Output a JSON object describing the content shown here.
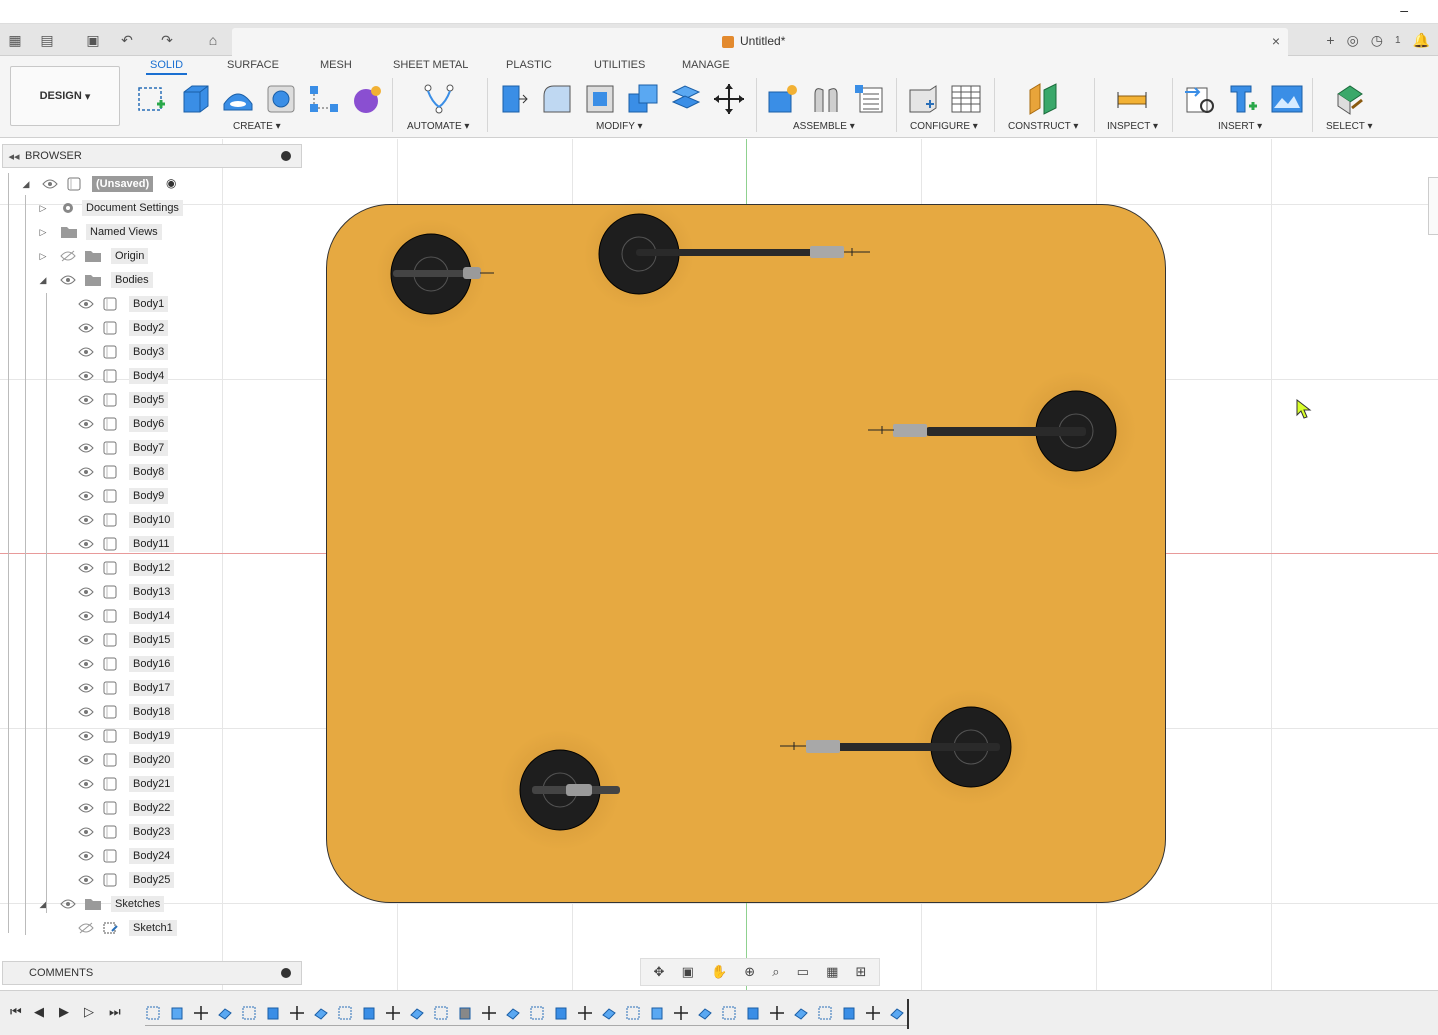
{
  "window": {
    "doc_title": "Untitled*",
    "minimize_glyph": "–",
    "close_glyph": "×"
  },
  "workspace": {
    "label": "DESIGN",
    "dropdown_glyph": "▾"
  },
  "tabs": [
    {
      "label": "SOLID",
      "active": true
    },
    {
      "label": "SURFACE"
    },
    {
      "label": "MESH"
    },
    {
      "label": "SHEET METAL"
    },
    {
      "label": "PLASTIC"
    },
    {
      "label": "UTILITIES"
    },
    {
      "label": "MANAGE"
    }
  ],
  "groups": [
    {
      "label": "CREATE ▾"
    },
    {
      "label": "AUTOMATE ▾"
    },
    {
      "label": "MODIFY ▾"
    },
    {
      "label": "ASSEMBLE ▾"
    },
    {
      "label": "CONFIGURE ▾"
    },
    {
      "label": "CONSTRUCT ▾"
    },
    {
      "label": "INSPECT ▾"
    },
    {
      "label": "INSERT ▾"
    },
    {
      "label": "SELECT ▾"
    }
  ],
  "browser": {
    "title": "BROWSER",
    "root": "(Unsaved)",
    "items": [
      {
        "label": "Document Settings"
      },
      {
        "label": "Named Views"
      },
      {
        "label": "Origin"
      },
      {
        "label": "Bodies"
      }
    ],
    "bodies": [
      "Body1",
      "Body2",
      "Body3",
      "Body4",
      "Body5",
      "Body6",
      "Body7",
      "Body8",
      "Body9",
      "Body10",
      "Body11",
      "Body12",
      "Body13",
      "Body14",
      "Body15",
      "Body16",
      "Body17",
      "Body18",
      "Body19",
      "Body20",
      "Body21",
      "Body22",
      "Body23",
      "Body24",
      "Body25"
    ],
    "sketches": {
      "label": "Sketches",
      "items": [
        "Sketch1"
      ]
    }
  },
  "comments": {
    "title": "COMMENTS"
  },
  "status": {
    "jobs_count": "1"
  },
  "colors": {
    "accent": "#1a6fd1",
    "plate": "#e6a941",
    "cylinder": "#1e1e1e"
  }
}
